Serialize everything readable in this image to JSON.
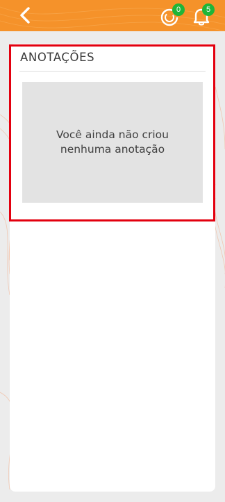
{
  "header": {
    "back_icon": "chevron-left-icon",
    "accent_color": "#f5922a",
    "progress_icon": "progress-ring-icon",
    "progress_count": "0",
    "notification_icon": "bell-icon",
    "notification_count": "5",
    "badge_color": "#1fb538"
  },
  "notes": {
    "title": "ANOTAÇÕES",
    "empty_message": "Você ainda não criou nenhuma anotação"
  },
  "highlight_color": "#e3000f"
}
